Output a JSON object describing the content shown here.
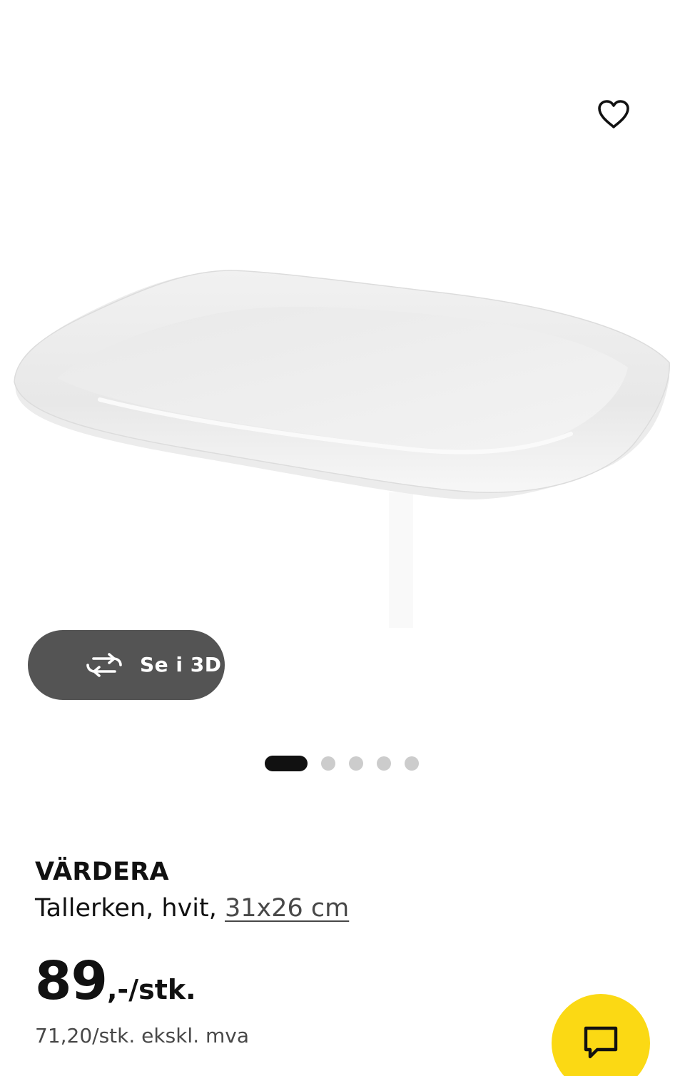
{
  "product": {
    "name": "VÄRDERA",
    "description": "Tallerken, hvit, ",
    "size": "31x26 cm",
    "price": "89",
    "price_suffix": ",-/stk.",
    "price_excl_vat": "71,20/stk. ekskl. mva"
  },
  "gallery": {
    "view3d_label": "Se i 3D",
    "active_index": 0,
    "image_count": 5
  },
  "icons": {
    "favorite": "heart-icon",
    "view3d": "rotate-3d-icon",
    "chat": "chat-icon"
  },
  "colors": {
    "chat_button": "#fbd914",
    "view3d_button": "#545454",
    "active_dot": "#111111",
    "inactive_dot": "#cccccc"
  }
}
